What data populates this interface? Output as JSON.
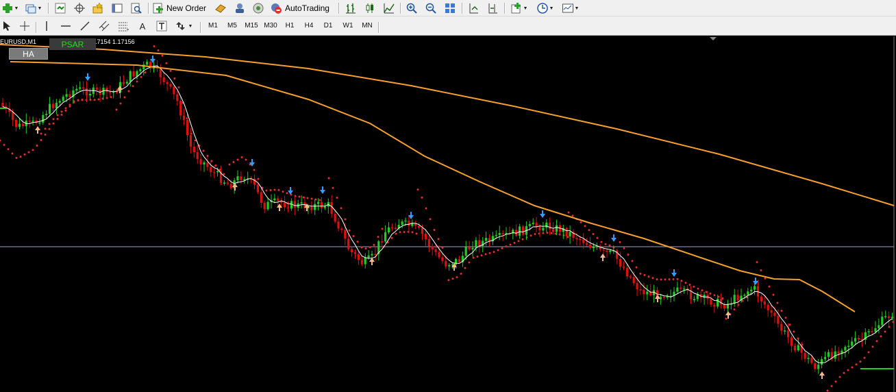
{
  "toolbar": {
    "new_order_label": "New Order",
    "autotrading_label": "AutoTrading",
    "text_tool_label": "A"
  },
  "timeframes": [
    "M1",
    "M5",
    "M15",
    "M30",
    "H1",
    "H4",
    "D1",
    "W1",
    "MN"
  ],
  "chart": {
    "symbol_label": "EURUSD,M1",
    "price_label": "1.17154 1.17156",
    "psar_button": "PSAR",
    "ha_button": "HA",
    "colors": {
      "background": "#000000",
      "bull_candle": "#22cc22",
      "bear_candle": "#dd1111",
      "psar": "#e03030",
      "ma_slow": "#f5a030",
      "ma_fast": "#ffffff",
      "sell_arrow": "#3a9bff",
      "buy_arrow": "#f5b98a",
      "level_line": "#9aa6c8"
    }
  }
}
